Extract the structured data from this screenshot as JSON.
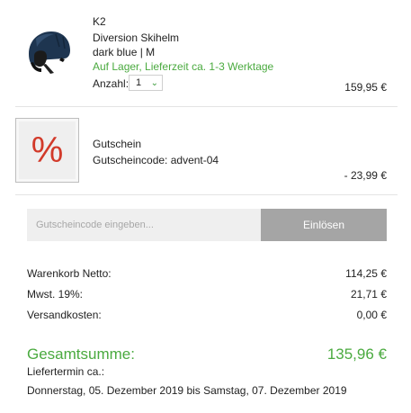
{
  "cart_item": {
    "brand": "K2",
    "name": "Diversion Skihelm",
    "variant": "dark blue | M",
    "availability": "Auf Lager, Lieferzeit ca. 1-3 Werktage",
    "quantity_label": "Anzahl:",
    "quantity_value": "1",
    "price": "159,95 €",
    "icon": "helmet-image"
  },
  "voucher": {
    "icon": "percent-icon",
    "symbol": "%",
    "title": "Gutschein",
    "code_line": "Gutscheincode: advent-04",
    "amount": "- 23,99 €"
  },
  "voucher_form": {
    "placeholder": "Gutscheincode eingeben...",
    "button_label": "Einlösen"
  },
  "summary": {
    "net_label": "Warenkorb Netto:",
    "net_value": "114,25 €",
    "tax_label": "Mwst. 19%:",
    "tax_value": "21,71 €",
    "shipping_label": "Versandkosten:",
    "shipping_value": "0,00 €",
    "total_label": "Gesamtsumme:",
    "total_value": "135,96 €",
    "delivery_label": "Liefertermin ca.:",
    "delivery_value": "Donnerstag, 05. Dezember 2019 bis Samstag, 07. Dezember 2019"
  },
  "colors": {
    "accent_green": "#4aaa3f",
    "percent_red": "#d23a2a",
    "button_gray": "#a5a5a5"
  }
}
